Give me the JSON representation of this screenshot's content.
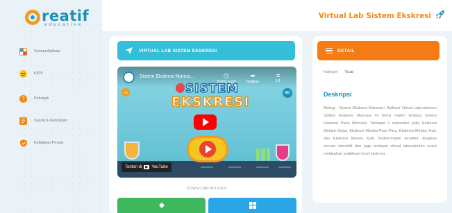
{
  "logo": {
    "word": "reatif",
    "sub": "educative"
  },
  "header": {
    "title": "Virtual Lab Sistem Ekskresi",
    "icon": "rocket-icon"
  },
  "sidebar": {
    "items": [
      {
        "label": "Semua Aplikasi",
        "icon": "apps-icon",
        "color": "#f08a12"
      },
      {
        "label": "KIDS",
        "icon": "kids-icon",
        "color": "#f39a1e"
      },
      {
        "label": "Petunjuk",
        "icon": "help-icon",
        "color": "#f08a12"
      },
      {
        "label": "Syarat & Ketentuan",
        "icon": "document-icon",
        "color": "#f08a12"
      },
      {
        "label": "Kebijakan Privasi",
        "icon": "shield-icon",
        "color": "#f08a12"
      }
    ]
  },
  "main": {
    "card_title": "VIRTUAL LAB SISTEM EKSKRESI",
    "video": {
      "title": "Sistem Ekskresi Manus...",
      "option_later": "Tonton nanti",
      "option_share": "Bagikan",
      "counter": "1/1",
      "banner_line1": "SISTEM",
      "banner_line2": "EKSKRESI",
      "watch_on": "Tonton di",
      "watch_brand": "YouTube"
    },
    "download_label": "DOWNLOAD APLIKASI",
    "android_icon": "android-icon",
    "windows_icon": "windows-icon"
  },
  "detail": {
    "title": "DETAIL",
    "kategori_label": "Kategori",
    "kategori_value": "VLab",
    "desc_title": "Deskripsi",
    "desc_text": "Biologi - Sistem Ekskresi Manusia | Aplikasi Virtual Laboratorium Sistem Ekskresi Manusia ini berisi materi tentang Sistem Ekskresi Pada Manusia. Terdapat 4 submateri yaitu Ekskresi Melalui Ginjal, Ekskresi Melalui Paru-Paru, Ekskresi Melalui Hati, dan Ekskresi Melalui Kulit. Materi-materi tersebut disajikan secara interaktif dan juga terdapat virtual laboratorium untuk melakukan praktikum hasil ekskresi."
  },
  "colors": {
    "brand_blue": "#1d90b8",
    "brand_orange": "#f08a12",
    "teal": "#33bfd8",
    "detail_orange": "#f57c14",
    "android_green": "#3fb85f",
    "windows_blue": "#2aa6e6"
  }
}
